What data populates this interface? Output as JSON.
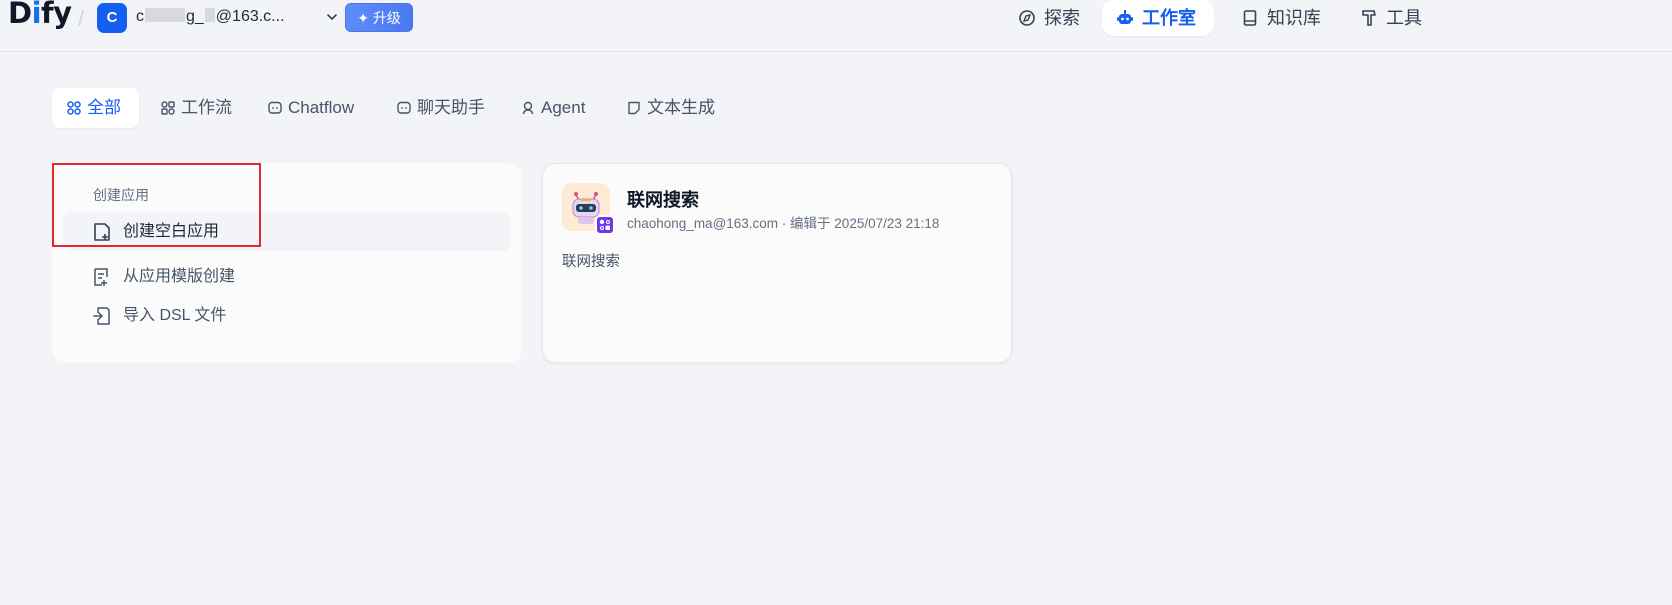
{
  "brand": {
    "logo_text_d": "D",
    "logo_text_i": "i",
    "logo_text_fy": "fy"
  },
  "workspace": {
    "avatar_letter": "C",
    "email_prefix": "c",
    "email_mid": "g_",
    "email_suffix": "@163.c...",
    "upgrade_label": "升级"
  },
  "nav": {
    "explore": "探索",
    "studio": "工作室",
    "knowledge": "知识库",
    "tools": "工具"
  },
  "tabs": [
    {
      "label": "全部",
      "active": true
    },
    {
      "label": "工作流"
    },
    {
      "label": "Chatflow"
    },
    {
      "label": "聊天助手"
    },
    {
      "label": "Agent"
    },
    {
      "label": "文本生成"
    }
  ],
  "create": {
    "title": "创建应用",
    "items": [
      {
        "label": "创建空白应用"
      },
      {
        "label": "从应用模版创建"
      },
      {
        "label": "导入 DSL 文件"
      }
    ]
  },
  "app": {
    "name": "联网搜索",
    "meta": "chaohong_ma@163.com · 编辑于 2025/07/23 21:18",
    "description": "联网搜索"
  },
  "colors": {
    "accent": "#155eef",
    "highlight_box": "#e0282e",
    "background": "#f2f4f7"
  }
}
